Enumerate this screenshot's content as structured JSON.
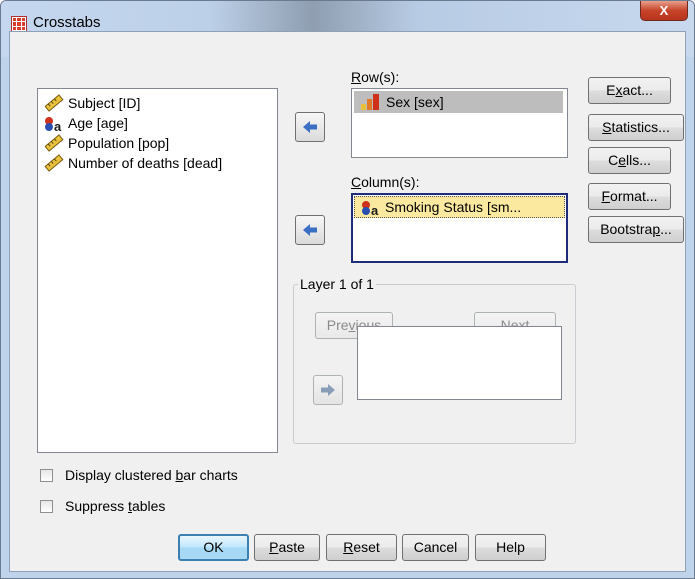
{
  "window": {
    "title": "Crosstabs",
    "close_glyph": "X"
  },
  "variables": [
    {
      "label": "Subject [ID]",
      "icon": "ruler-scale-icon"
    },
    {
      "label": "Age [age]",
      "icon": "nominal-icon"
    },
    {
      "label": "Population [pop]",
      "icon": "ruler-scale-icon"
    },
    {
      "label": "Number of deaths [dead]",
      "icon": "ruler-scale-icon"
    }
  ],
  "rows": {
    "label_pre": "",
    "label_u": "R",
    "label_post": "ow(s):",
    "item": "Sex [sex]",
    "item_icon": "ordinal-icon"
  },
  "columns": {
    "label_pre": "",
    "label_u": "C",
    "label_post": "olumn(s):",
    "item": "Smoking Status [sm...",
    "item_icon": "nominal-icon"
  },
  "layer": {
    "label": "Layer 1 of 1",
    "previous_pre": "Pre",
    "previous_u": "v",
    "previous_post": "ious",
    "next_pre": "",
    "next_u": "N",
    "next_post": "ext"
  },
  "side_buttons": {
    "exact": {
      "pre": "E",
      "u": "x",
      "post": "act..."
    },
    "statistics": {
      "pre": "",
      "u": "S",
      "post": "tatistics..."
    },
    "cells": {
      "pre": "C",
      "u": "e",
      "post": "lls..."
    },
    "format": {
      "pre": "",
      "u": "F",
      "post": "ormat..."
    },
    "bootstrap": {
      "pre": "Bootstra",
      "u": "p",
      "post": "..."
    }
  },
  "options": {
    "clustered_pre": "Display clustered ",
    "clustered_u": "b",
    "clustered_post": "ar charts",
    "clustered_checked": false,
    "suppress_pre": "Suppress ",
    "suppress_u": "t",
    "suppress_post": "ables",
    "suppress_checked": false
  },
  "footer": {
    "ok": "OK",
    "paste_u": "P",
    "paste_post": "aste",
    "reset_u": "R",
    "reset_post": "eset",
    "cancel": "Cancel",
    "help": "Help"
  },
  "colors": {
    "accent_arrow": "#3a6fc4",
    "selected_row": "#bdbdbd",
    "selected_col": "#fce9a0",
    "ordinal_red": "#d0311b"
  }
}
